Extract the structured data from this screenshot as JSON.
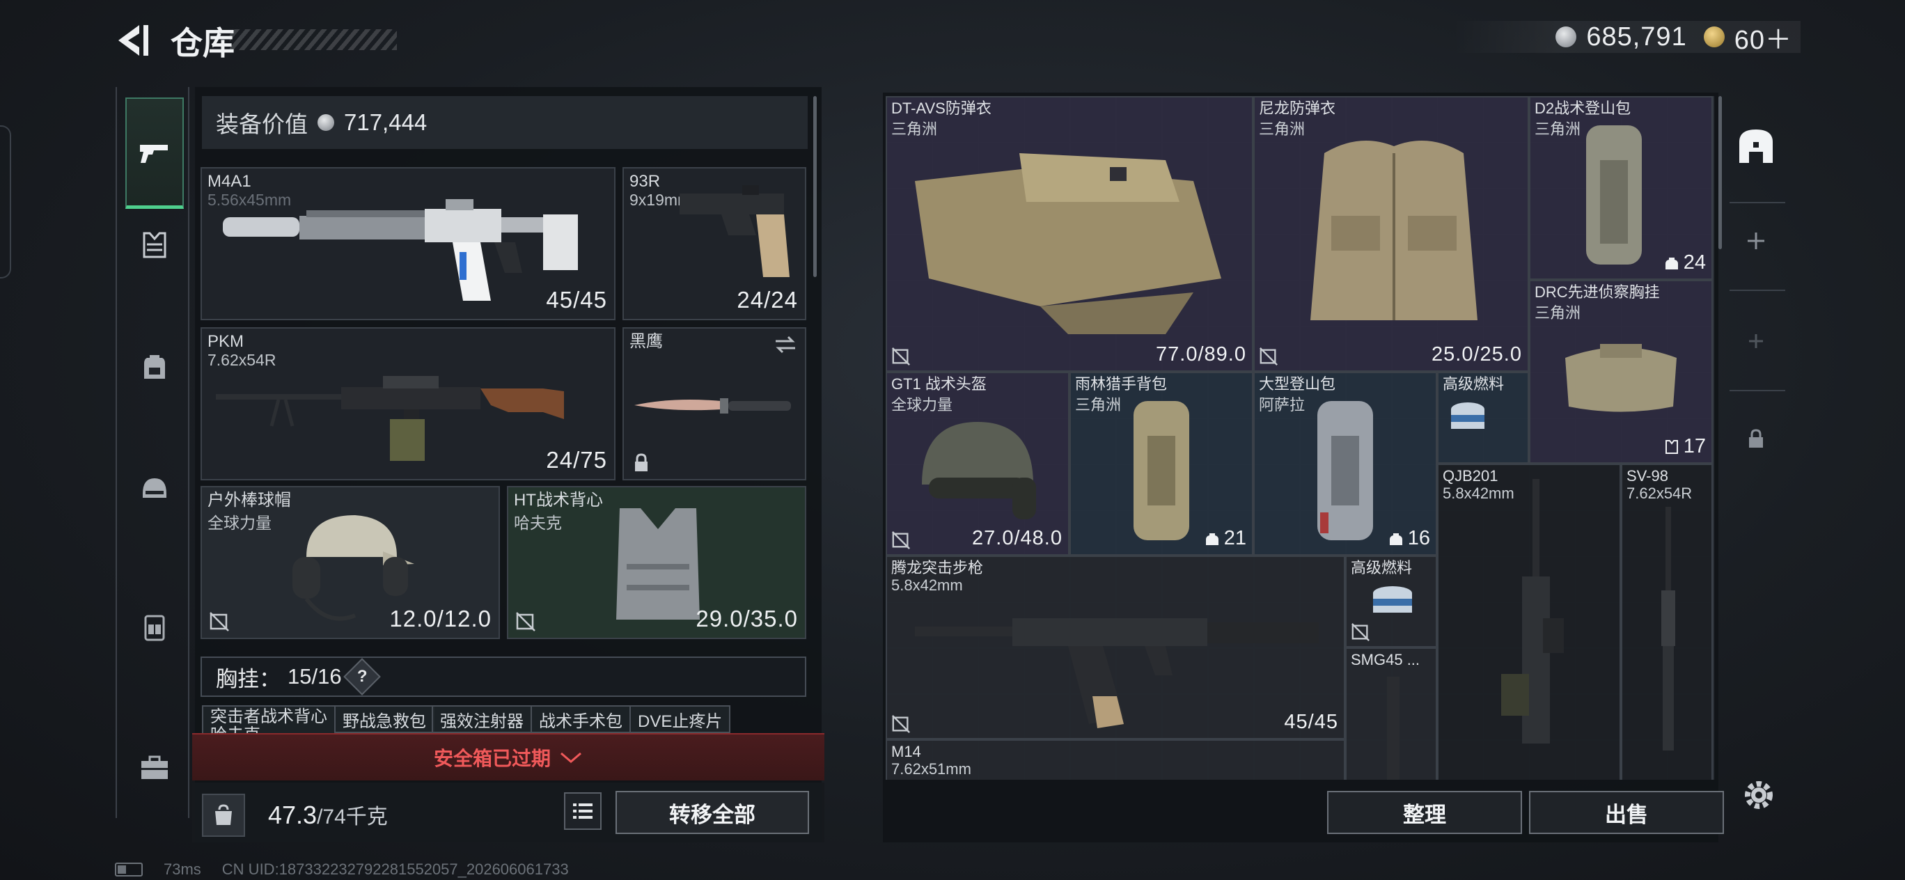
{
  "header": {
    "title": "仓库",
    "currency_silver": "685,791",
    "currency_gold": "60＋"
  },
  "sidebar": {
    "items": [
      {
        "name": "weapons",
        "active": true
      },
      {
        "name": "armor"
      },
      {
        "name": "backpack"
      },
      {
        "name": "helmet"
      },
      {
        "name": "chest-rig"
      },
      {
        "name": "toolbox"
      }
    ]
  },
  "loadout": {
    "value_label": "装备价值",
    "value": "717,444",
    "primary": {
      "name": "M4A1",
      "caliber": "5.56x45mm",
      "value": "45/45"
    },
    "pistol": {
      "name": "93R",
      "caliber": "9x19mm",
      "value": "24/24"
    },
    "secondary": {
      "name": "PKM",
      "caliber": "7.62x54R",
      "value": "24/75"
    },
    "melee": {
      "name": "黑鹰"
    },
    "helmet": {
      "name": "户外棒球帽",
      "map": "全球力量",
      "value": "12.0/12.0"
    },
    "vest": {
      "name": "HT战术背心",
      "map": "哈夫克",
      "value": "29.0/35.0"
    },
    "chest_label": "胸挂：",
    "chest_count": "15/16",
    "chest_help": "?",
    "chest_items": [
      "突击者战术背心",
      "哈夫克",
      "野战急救包",
      "强效注射器",
      "战术手术包",
      "DVE止疼片"
    ],
    "secure_case": "安全箱已过期",
    "weight_current": "47.3",
    "weight_max": "/74千克",
    "transfer_all": "转移全部"
  },
  "storage": {
    "items": [
      {
        "name": "DT-AVS防弹衣",
        "map": "三角洲",
        "value": "77.0/89.0"
      },
      {
        "name": "尼龙防弹衣",
        "map": "三角洲",
        "value": "25.0/25.0"
      },
      {
        "name": "D2战术登山包",
        "map": "三角洲",
        "value": "24"
      },
      {
        "name": "DRC先进侦察胸挂",
        "map": "三角洲",
        "value": "17"
      },
      {
        "name": "GT1 战术头盔",
        "map": "全球力量",
        "value": "27.0/48.0"
      },
      {
        "name": "雨林猎手背包",
        "map": "三角洲",
        "value": "21"
      },
      {
        "name": "大型登山包",
        "map": "阿萨拉",
        "value": "16"
      },
      {
        "name": "高级燃料"
      },
      {
        "name": "QJB201",
        "map": "5.8x42mm"
      },
      {
        "name": "SV-98",
        "map": "7.62x54R"
      },
      {
        "name": "腾龙突击步枪",
        "map": "5.8x42mm",
        "value": "45/45"
      },
      {
        "name": "高级燃料"
      },
      {
        "name": "SMG45 ..."
      },
      {
        "name": "M14",
        "map": "7.62x51mm"
      }
    ],
    "sort": "整理",
    "sell": "出售"
  },
  "footer": {
    "ping": "73ms",
    "uid": "CN UID:187332232792281552057_202606061733"
  }
}
